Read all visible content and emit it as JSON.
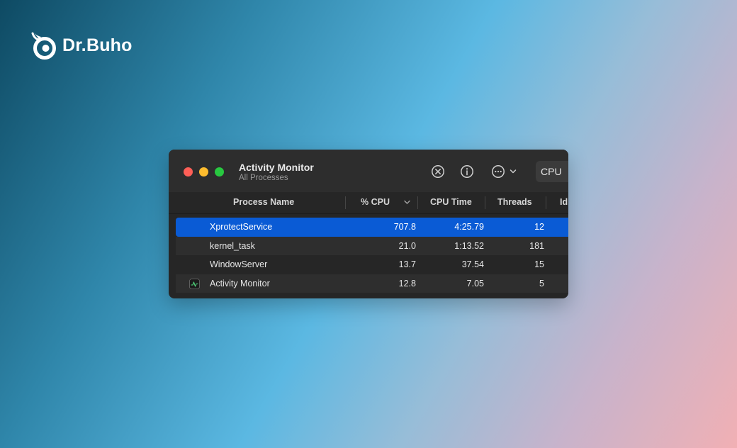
{
  "brand": {
    "name": "Dr.Buho",
    "logo_icon": "owl-logo-icon"
  },
  "window": {
    "title": "Activity Monitor",
    "subtitle": "All Processes",
    "toolbar": {
      "stop_icon": "stop-process-icon",
      "info_icon": "info-icon",
      "more_icon": "more-options-icon",
      "tab_label": "CPU"
    },
    "columns": {
      "name": "Process Name",
      "cpu": "% CPU",
      "cpu_time": "CPU Time",
      "threads": "Threads",
      "idle": "Id"
    },
    "processes": [
      {
        "name": "XprotectService",
        "cpu": "707.8",
        "cpu_time": "4:25.79",
        "threads": "12",
        "selected": true
      },
      {
        "name": "kernel_task",
        "cpu": "21.0",
        "cpu_time": "1:13.52",
        "threads": "181"
      },
      {
        "name": "WindowServer",
        "cpu": "13.7",
        "cpu_time": "37.54",
        "threads": "15"
      },
      {
        "name": "Activity Monitor",
        "cpu": "12.8",
        "cpu_time": "7.05",
        "threads": "5",
        "icon": "activity-monitor-app-icon"
      }
    ]
  },
  "colors": {
    "selection": "#0a5bd5",
    "window_bg": "#262626",
    "close": "#fe5f57",
    "minimize": "#febc2e",
    "maximize": "#28c840"
  }
}
